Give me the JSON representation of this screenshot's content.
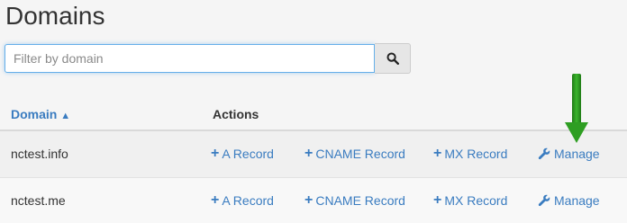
{
  "page": {
    "title": "Domains"
  },
  "search": {
    "placeholder": "Filter by domain",
    "value": "",
    "button_icon": "search-icon"
  },
  "table": {
    "columns": {
      "domain": "Domain",
      "domain_sort_indicator": "▲",
      "actions": "Actions"
    },
    "rows": [
      {
        "domain": "nctest.info",
        "actions": {
          "a_record": "A Record",
          "cname_record": "CNAME Record",
          "mx_record": "MX Record",
          "manage": "Manage"
        }
      },
      {
        "domain": "nctest.me",
        "actions": {
          "a_record": "A Record",
          "cname_record": "CNAME Record",
          "mx_record": "MX Record",
          "manage": "Manage"
        }
      }
    ]
  },
  "icons": {
    "plus": "+",
    "wrench": "wrench-icon",
    "annotation_arrow": "arrow-down-icon"
  },
  "colors": {
    "link": "#3a7cc0",
    "arrow": "#2e9e22",
    "focus_border": "#66afe9"
  }
}
